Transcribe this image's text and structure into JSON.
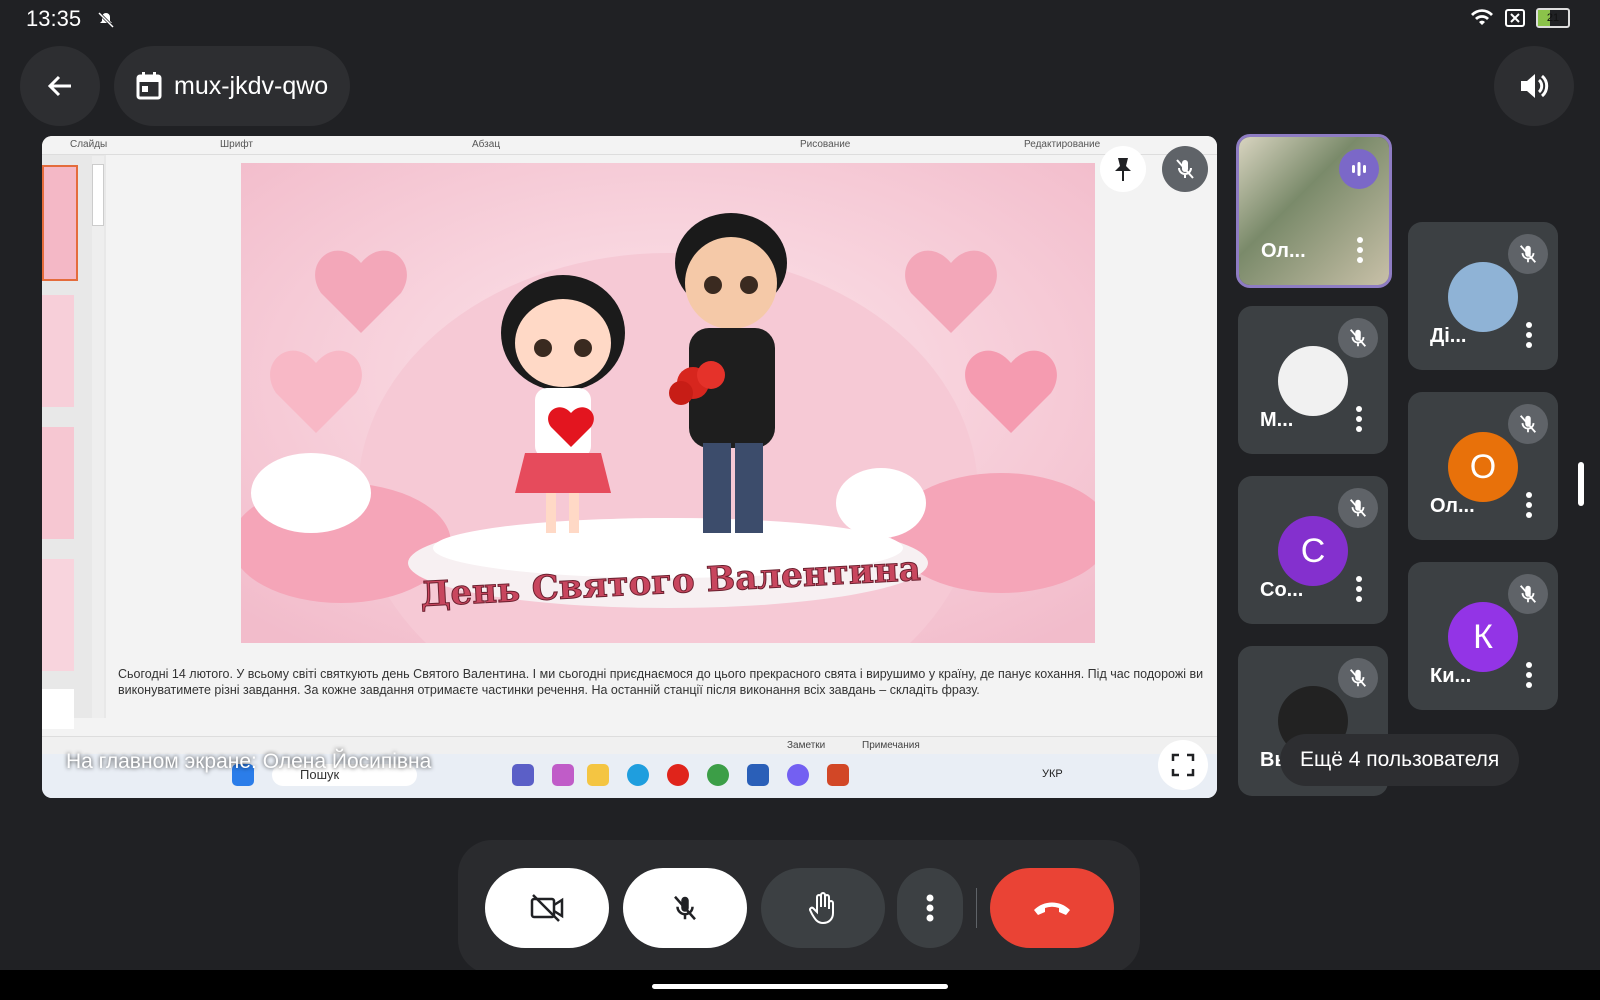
{
  "status_bar": {
    "time": "13:35",
    "battery": "21"
  },
  "header": {
    "meeting_code": "mux-jkdv-qwo"
  },
  "presentation": {
    "ribbon": [
      "Слайды",
      "Шрифт",
      "Абзац",
      "Рисование",
      "Редактирование"
    ],
    "slide_title": "День Святого Валентина",
    "notes": "Сьогодні 14 лютого. У всьому світі святкують день Святого Валентина. І ми сьогодні приєднаємося до цього прекрасного свята і вирушимо у країну, де панує кохання. Під час подорожі ви виконуватимете різні завдання. За кожне завдання отримаєте частинки речення. На останній станції після виконання всіх завдань – складіть фразу.",
    "status": {
      "notes": "Заметки",
      "comments": "Примечания"
    },
    "taskbar": {
      "search": "Пошук",
      "lang": "УКР"
    },
    "caption": "На главном экране: Олена Йосипівна"
  },
  "participants": [
    {
      "name": "Ол...",
      "avatar_letter": "",
      "color": "#7a8a6a"
    },
    {
      "name": "Ді...",
      "avatar_letter": "",
      "color": "#8fb3d6"
    },
    {
      "name": "М...",
      "avatar_letter": "",
      "color": "#f1f1f1"
    },
    {
      "name": "Ол...",
      "avatar_letter": "О",
      "color": "#e8710a"
    },
    {
      "name": "Со...",
      "avatar_letter": "С",
      "color": "#8430ce"
    },
    {
      "name": "Ки...",
      "avatar_letter": "К",
      "color": "#9334e6"
    },
    {
      "name": "Вы",
      "avatar_letter": "",
      "color": "#222"
    }
  ],
  "more_users": "Ещё 4 пользователя",
  "colors": {
    "end_call": "#ea4335",
    "active_speaker": "#8e7cc3"
  }
}
